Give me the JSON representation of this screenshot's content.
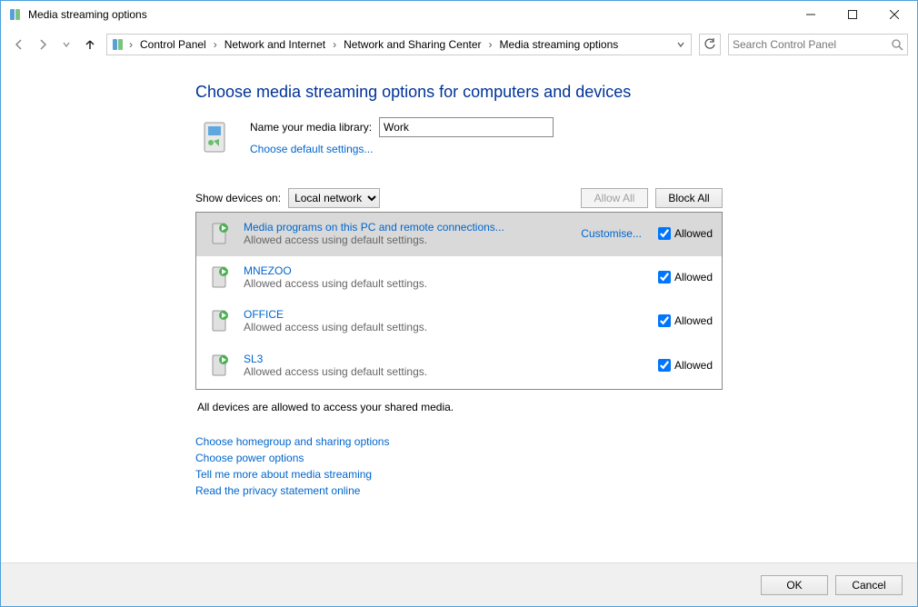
{
  "window": {
    "title": "Media streaming options"
  },
  "breadcrumb": {
    "segments": [
      "Control Panel",
      "Network and Internet",
      "Network and Sharing Center",
      "Media streaming options"
    ]
  },
  "search": {
    "placeholder": "Search Control Panel"
  },
  "page": {
    "heading": "Choose media streaming options for computers and devices",
    "library_name_label": "Name your media library:",
    "library_name_value": "Work",
    "choose_defaults_link": "Choose default settings...",
    "show_devices_label": "Show devices on:",
    "show_devices_value": "Local network",
    "allow_all_label": "Allow All",
    "block_all_label": "Block All",
    "status_line": "All devices are allowed to access your shared media.",
    "links": [
      "Choose homegroup and sharing options",
      "Choose power options",
      "Tell me more about media streaming",
      "Read the privacy statement online"
    ]
  },
  "devices": [
    {
      "name": "Media programs on this PC and remote connections...",
      "sub": "Allowed access using default settings.",
      "customise": "Customise...",
      "allowed_label": "Allowed",
      "allowed": true,
      "selected": true
    },
    {
      "name": "MNEZOO",
      "sub": "Allowed access using default settings.",
      "allowed_label": "Allowed",
      "allowed": true,
      "selected": false
    },
    {
      "name": "OFFICE",
      "sub": "Allowed access using default settings.",
      "allowed_label": "Allowed",
      "allowed": true,
      "selected": false
    },
    {
      "name": "SL3",
      "sub": "Allowed access using default settings.",
      "allowed_label": "Allowed",
      "allowed": true,
      "selected": false
    }
  ],
  "footer": {
    "ok": "OK",
    "cancel": "Cancel"
  }
}
